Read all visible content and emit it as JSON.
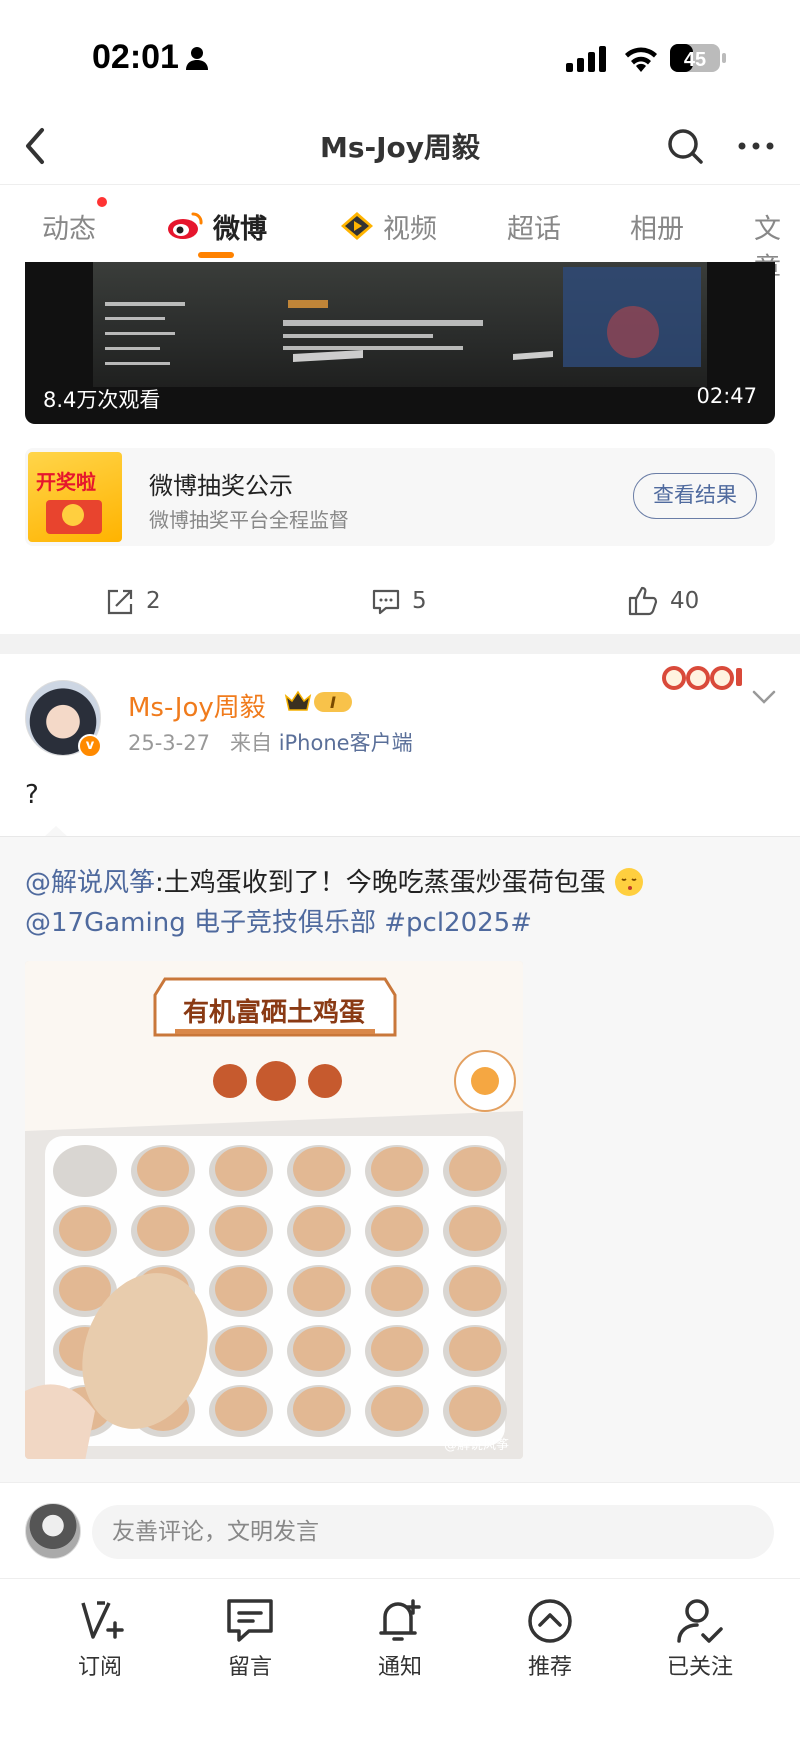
{
  "status_bar": {
    "time": "02:01",
    "battery": "45"
  },
  "header": {
    "title": "Ms-Joy周毅"
  },
  "tabs": [
    {
      "label": "动态"
    },
    {
      "label": "微博"
    },
    {
      "label": "视频"
    },
    {
      "label": "超话"
    },
    {
      "label": "相册"
    },
    {
      "label": "文章"
    }
  ],
  "video": {
    "views": "8.4万次观看",
    "duration": "02:47"
  },
  "lottery": {
    "badge": "开奖啦",
    "title": "微博抽奖公示",
    "subtitle": "微博抽奖平台全程监督",
    "button": "查看结果"
  },
  "actions": {
    "reposts": "2",
    "comments": "5",
    "likes": "40"
  },
  "post": {
    "username": "Ms-Joy周毅",
    "level": "I",
    "date": "25-3-27",
    "source_prefix": "来自",
    "source": "iPhone客户端",
    "text": "?",
    "repost": {
      "mention": "@解说风筝",
      "text": ":土鸡蛋收到了！今晚吃蒸蛋炒蛋荷包蛋",
      "mention2": "@17Gaming 电子竞技俱乐部",
      "hashtag": "#pcl2025#",
      "image_title": "有机富硒土鸡蛋",
      "image_watermark": "@解说风筝"
    }
  },
  "comment_bar": {
    "placeholder": "友善评论，文明发言"
  },
  "bottom_nav": [
    {
      "label": "订阅"
    },
    {
      "label": "留言"
    },
    {
      "label": "通知"
    },
    {
      "label": "推荐"
    },
    {
      "label": "已关注"
    }
  ],
  "colors": {
    "accent": "#ff8200",
    "link": "#4f6a9e",
    "username": "#f07b1c"
  }
}
